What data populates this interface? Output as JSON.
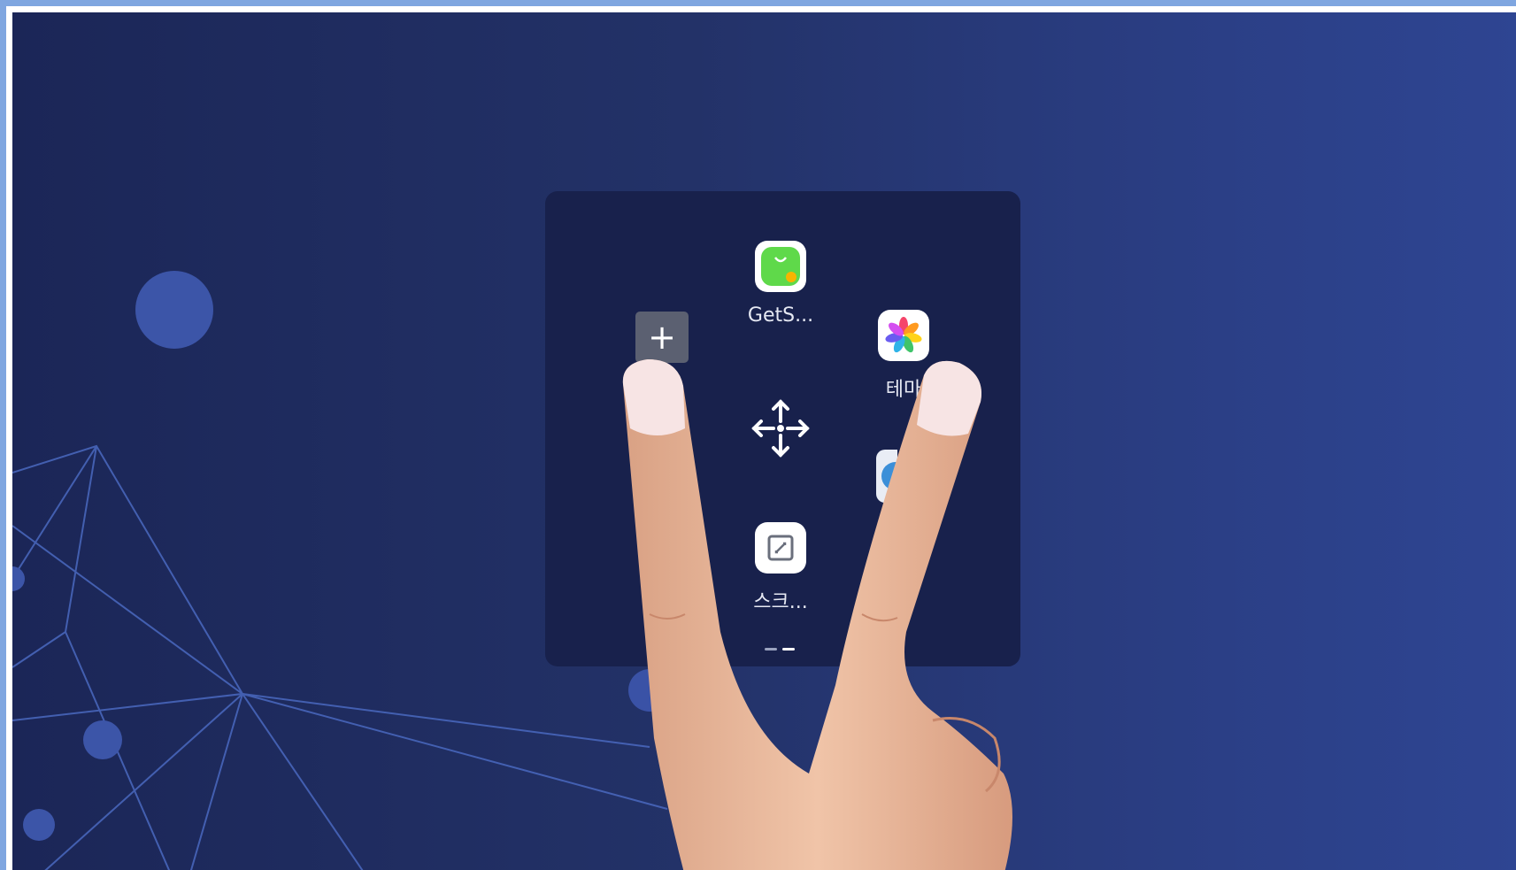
{
  "panel": {
    "add_label": "+",
    "apps": [
      {
        "name": "getsapps",
        "label": "GetS..."
      },
      {
        "name": "themes",
        "label": "테마"
      },
      {
        "name": "screenshot",
        "label": "스크..."
      }
    ],
    "page_indicator": {
      "pages": 2,
      "current": 2
    }
  },
  "colors": {
    "background_left": "#1b2657",
    "background_right": "#2e4592",
    "panel": "#18214c",
    "accent_line": "#4a69c0",
    "frame_border": "#7fa6e0"
  },
  "icons": [
    "plus-icon",
    "getsapps-bag-icon",
    "theme-flower-icon",
    "move-arrows-icon",
    "screenshot-resize-icon"
  ]
}
